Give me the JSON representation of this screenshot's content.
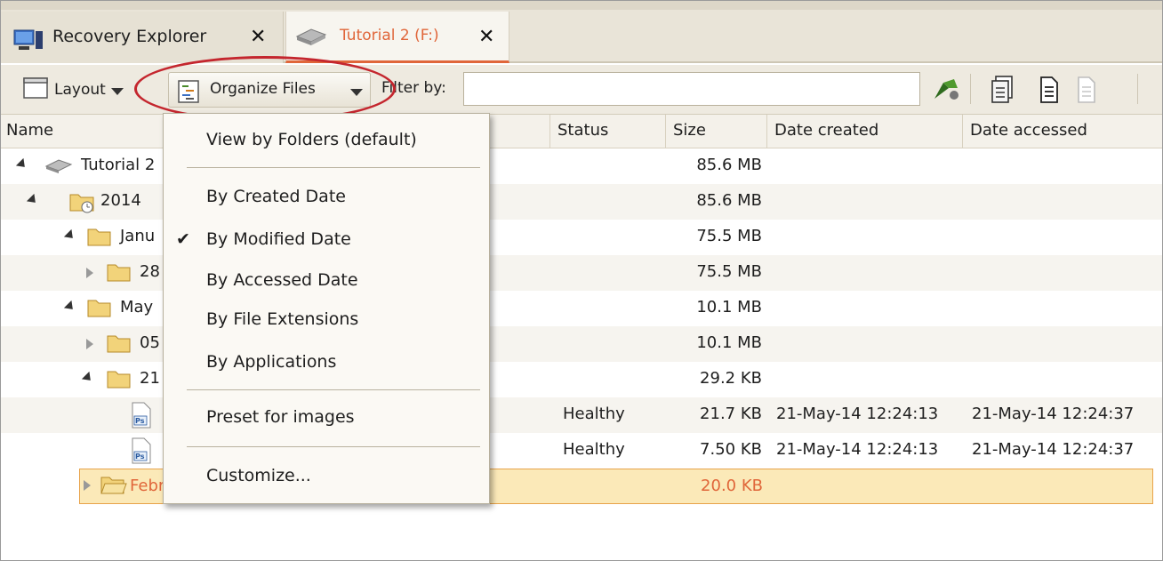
{
  "tabs": [
    {
      "label": "Recovery Explorer",
      "icon": "computer-icon"
    },
    {
      "label": "Tutorial 2 (F:)",
      "icon": "drive-icon",
      "active": true
    }
  ],
  "toolbar": {
    "layout_label": "Layout",
    "organize_label": "Organize Files",
    "filter_label": "Filter by:",
    "filter_value": ""
  },
  "columns": {
    "name": "Name",
    "status": "Status",
    "size": "Size",
    "created": "Date created",
    "accessed": "Date accessed"
  },
  "rows": [
    {
      "name": "Tutorial 2",
      "status": "",
      "size": "85.6 MB",
      "created": "",
      "accessed": ""
    },
    {
      "name": "2014",
      "status": "",
      "size": "85.6 MB",
      "created": "",
      "accessed": ""
    },
    {
      "name": "Janu",
      "status": "",
      "size": "75.5 MB",
      "created": "",
      "accessed": ""
    },
    {
      "name": "28",
      "status": "",
      "size": "75.5 MB",
      "created": "",
      "accessed": ""
    },
    {
      "name": "May",
      "status": "",
      "size": "10.1 MB",
      "created": "",
      "accessed": ""
    },
    {
      "name": "05",
      "status": "",
      "size": "10.1 MB",
      "created": "",
      "accessed": ""
    },
    {
      "name": "21",
      "status": "",
      "size": "29.2 KB",
      "created": "",
      "accessed": ""
    },
    {
      "name": "",
      "status": "Healthy",
      "size": "21.7 KB",
      "created": "21-May-14 12:24:13",
      "accessed": "21-May-14 12:24:37"
    },
    {
      "name": "",
      "status": "Healthy",
      "size": "7.50 KB",
      "created": "21-May-14 12:24:13",
      "accessed": "21-May-14 12:24:37"
    },
    {
      "name": "Febr",
      "status": "",
      "size": "20.0 KB",
      "created": "",
      "accessed": ""
    }
  ],
  "menu": {
    "items": [
      "View by Folders (default)",
      "By Created Date",
      "By Modified Date",
      "By Accessed Date",
      "By File Extensions",
      "By Applications",
      "Preset for images",
      "Customize..."
    ],
    "checked": "By Modified Date"
  },
  "colors": {
    "accent": "#e0663a",
    "highlight_oval": "#c4262e",
    "selected_row": "#fbe9b8"
  }
}
